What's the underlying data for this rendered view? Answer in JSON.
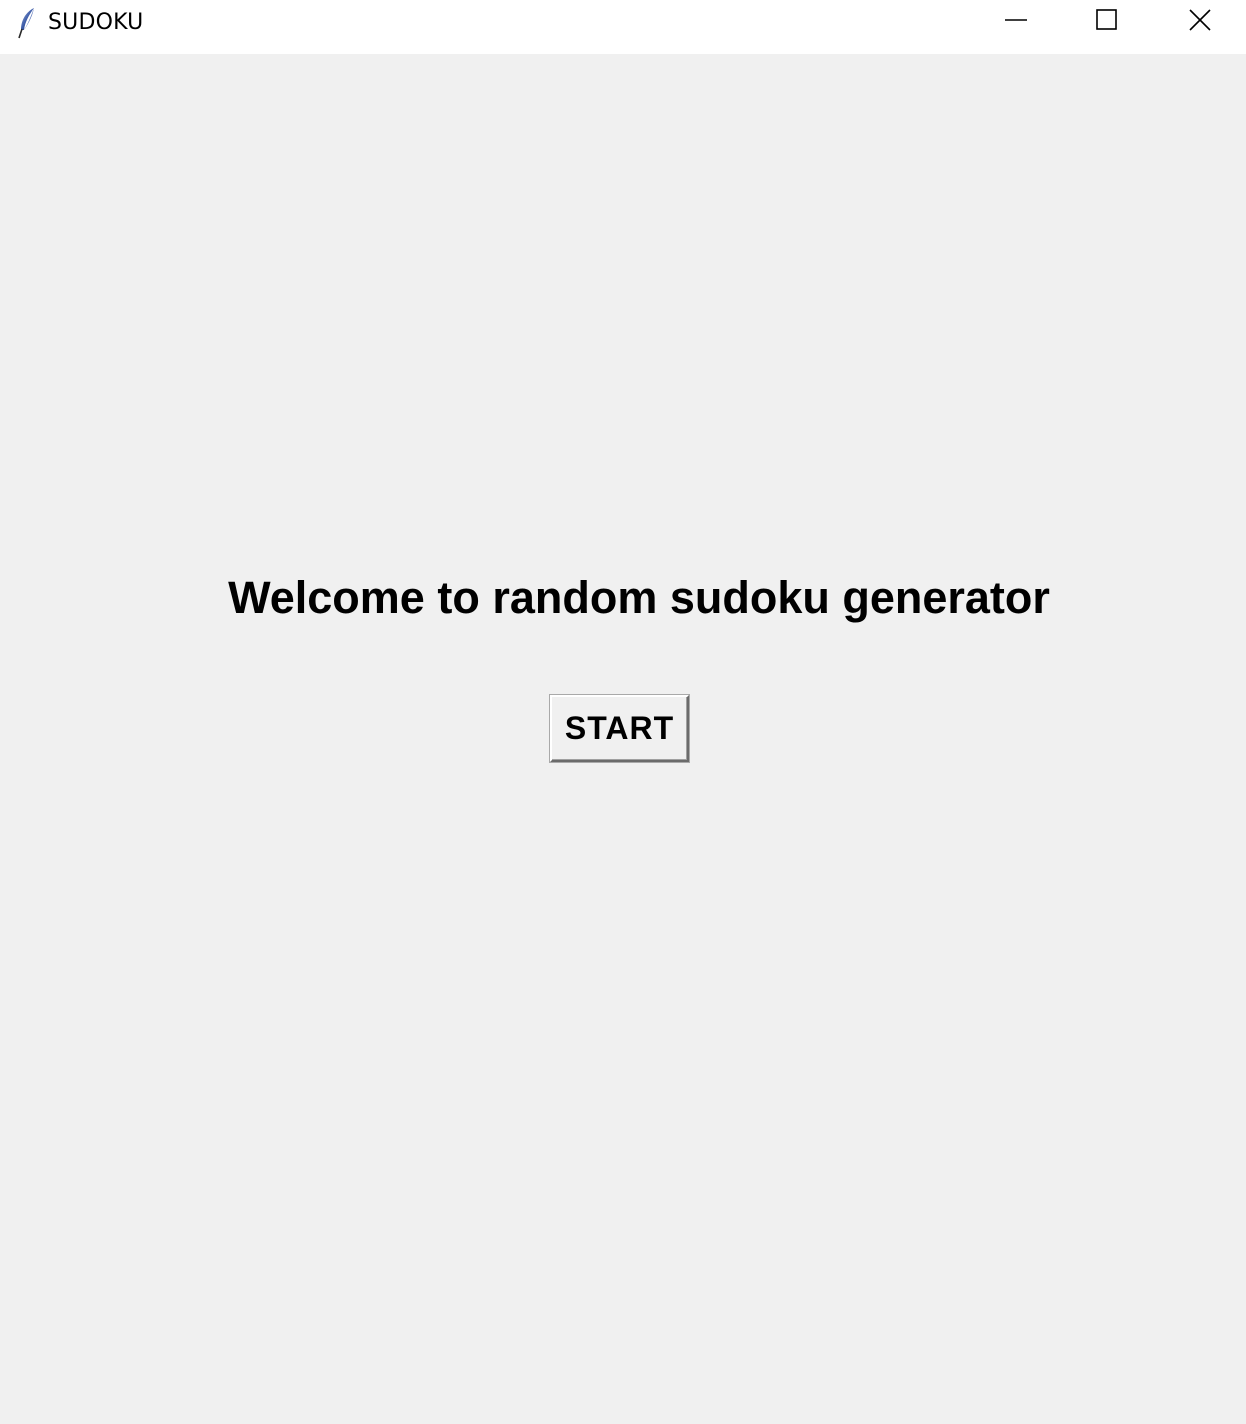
{
  "window": {
    "title": "SUDOKU",
    "app_icon": "feather-icon",
    "controls": {
      "minimize_icon": "minimize-icon",
      "maximize_icon": "maximize-icon",
      "close_icon": "close-icon"
    }
  },
  "main": {
    "welcome_text": "Welcome to random sudoku generator",
    "start_button_label": "START"
  },
  "colors": {
    "titlebar": "#ffffff",
    "background": "#f0f0f0",
    "text": "#000000"
  }
}
